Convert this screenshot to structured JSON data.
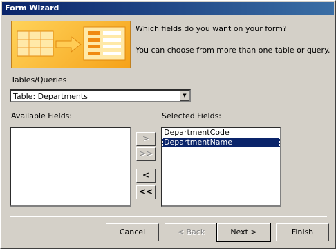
{
  "window": {
    "title": "Form Wizard"
  },
  "header": {
    "question": "Which fields do you want on your form?",
    "hint": "You can choose from more than one table or query."
  },
  "tables": {
    "label": "Tables/Queries",
    "selected": "Table: Departments"
  },
  "available": {
    "label": "Available Fields:",
    "items": []
  },
  "selected_fields": {
    "label": "Selected Fields:",
    "items": [
      "DepartmentCode",
      "DepartmentName"
    ],
    "highlighted_index": 1
  },
  "move_buttons": {
    "add_one": ">",
    "add_all": ">>",
    "remove_one": "<",
    "remove_all": "<<"
  },
  "footer": {
    "cancel": "Cancel",
    "back": "< Back",
    "next": "Next >",
    "finish": "Finish"
  },
  "icons": {
    "banner": "form-wizard-illustration",
    "dropdown": "chevron-down-icon"
  }
}
